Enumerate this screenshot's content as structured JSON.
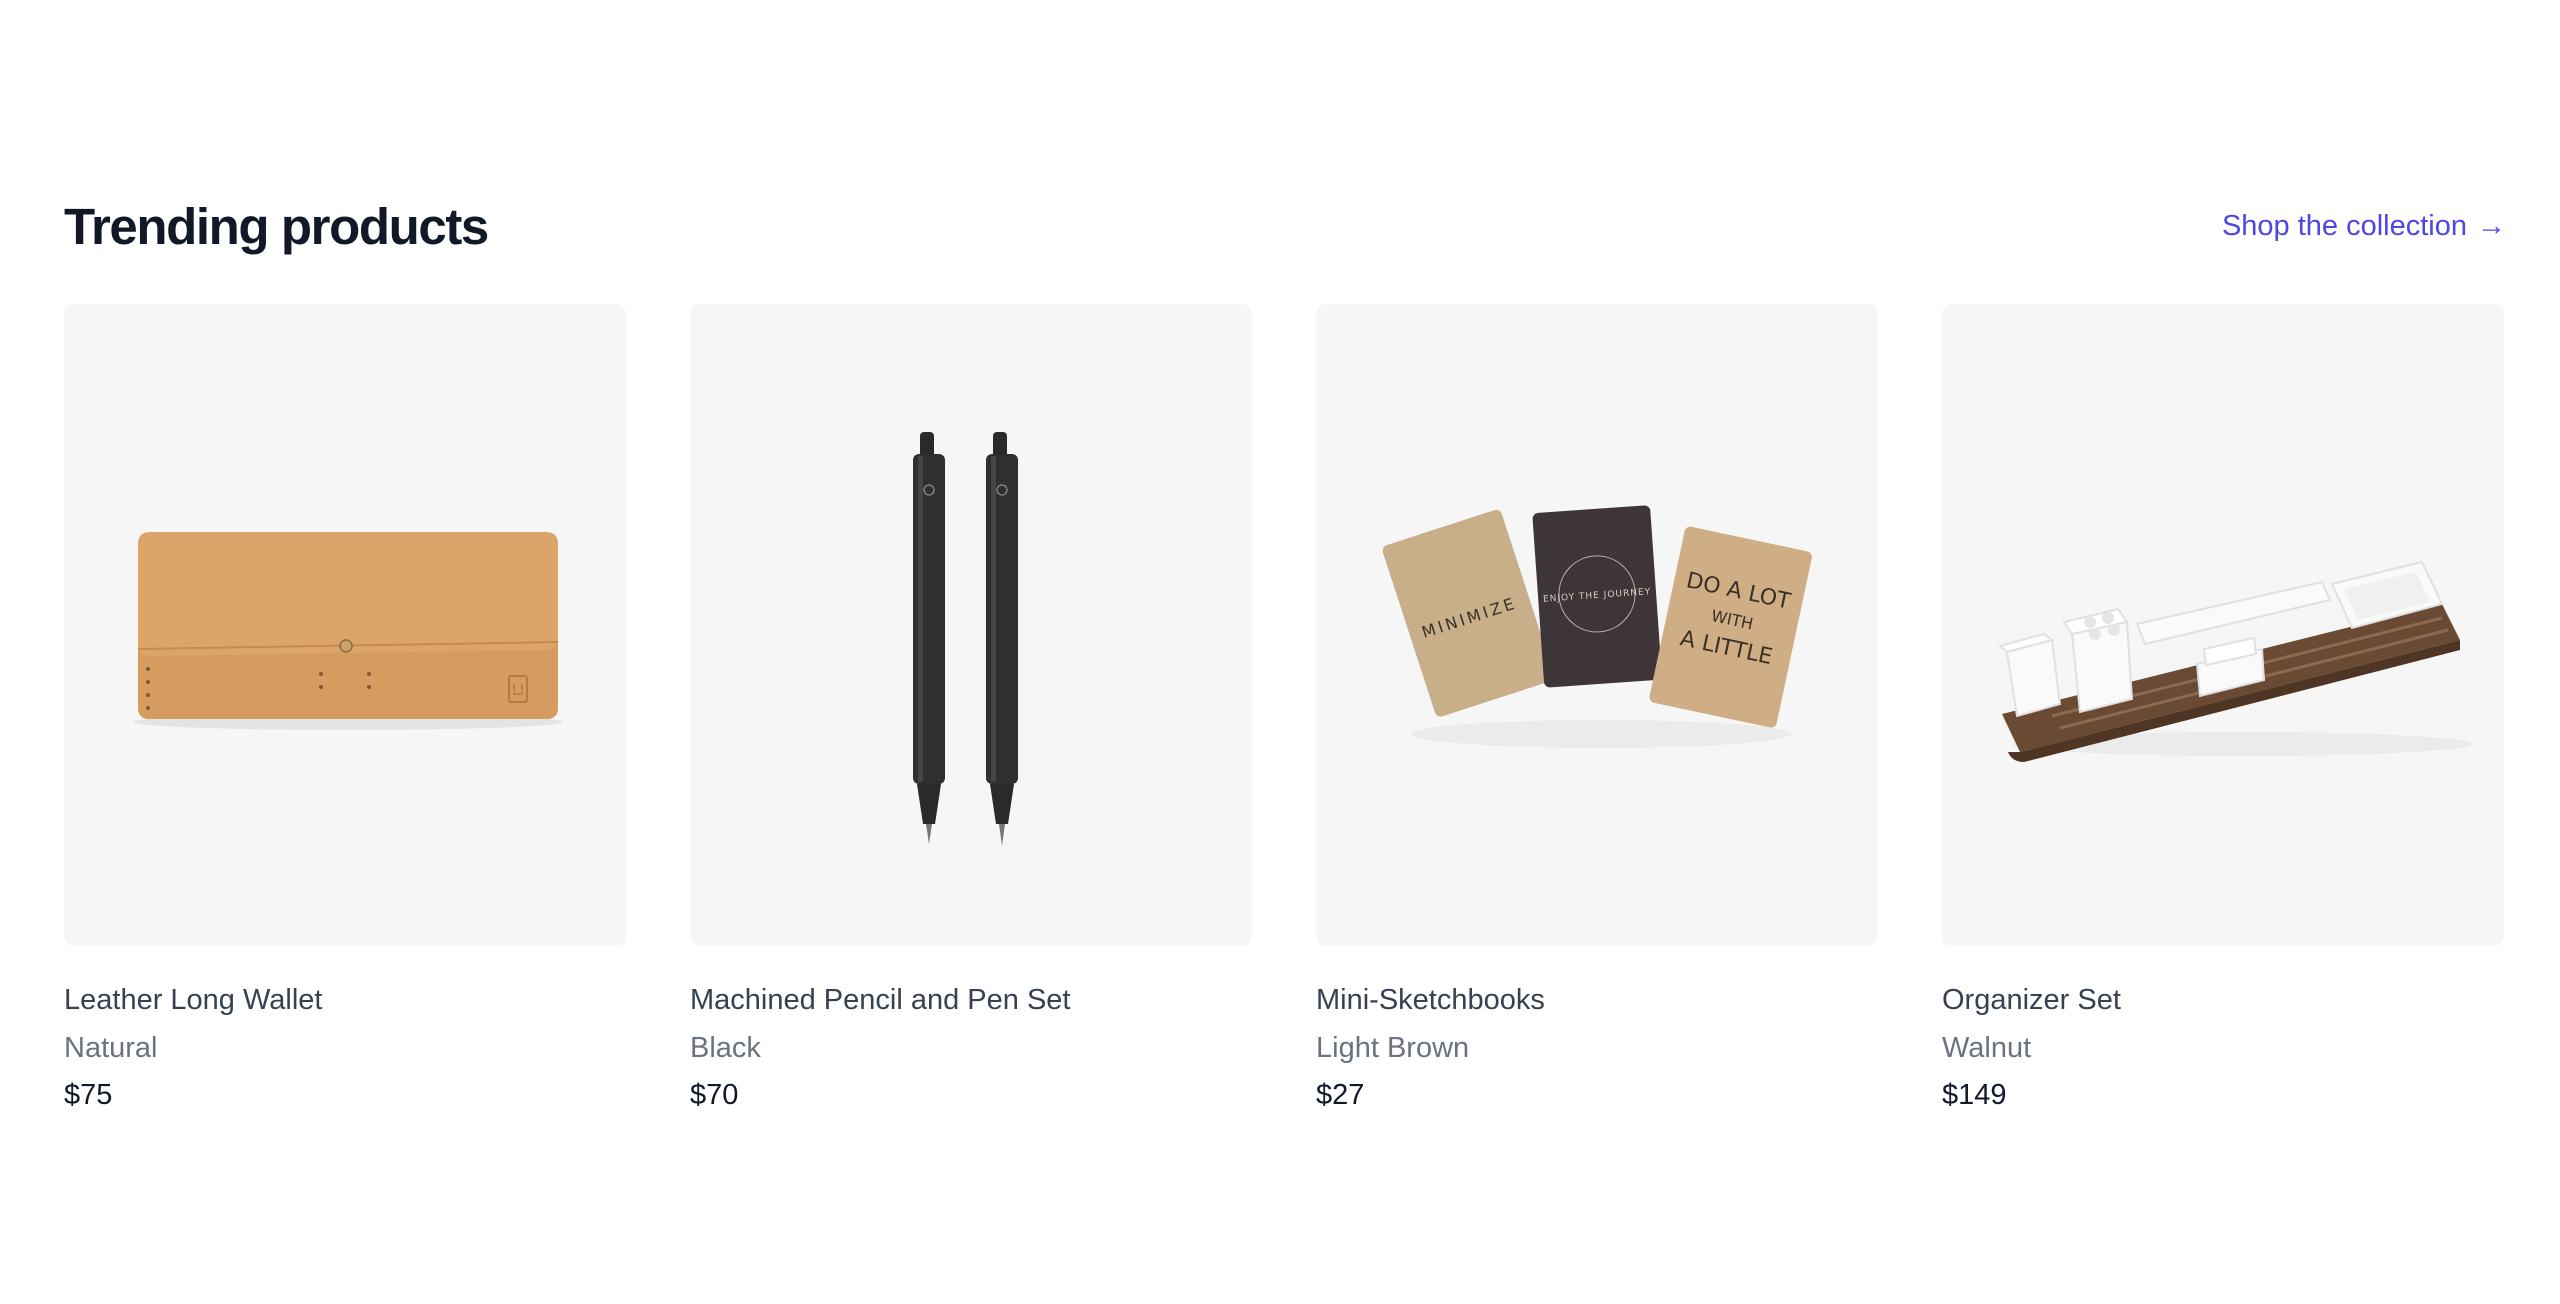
{
  "header": {
    "title": "Trending products",
    "link_label": "Shop the collection",
    "link_arrow": "→"
  },
  "products": [
    {
      "name": "Leather Long Wallet",
      "color": "Natural",
      "price": "$75",
      "image": "wallet-image"
    },
    {
      "name": "Machined Pencil and Pen Set",
      "color": "Black",
      "price": "$70",
      "image": "pens-image"
    },
    {
      "name": "Mini-Sketchbooks",
      "color": "Light Brown",
      "price": "$27",
      "image": "sketchbooks-image",
      "cover_text": {
        "left": "MINIMIZE",
        "middle": "ENJOY THE JOURNEY",
        "right_lines": [
          "DO A LOT",
          "WITH",
          "A LITTLE"
        ]
      }
    },
    {
      "name": "Organizer Set",
      "color": "Walnut",
      "price": "$149",
      "image": "organizer-image"
    }
  ],
  "colors": {
    "accent": "#4f46e5",
    "image_background": "#f6f6f6",
    "leather": "#d9a368",
    "walnut": "#6b4a33"
  }
}
